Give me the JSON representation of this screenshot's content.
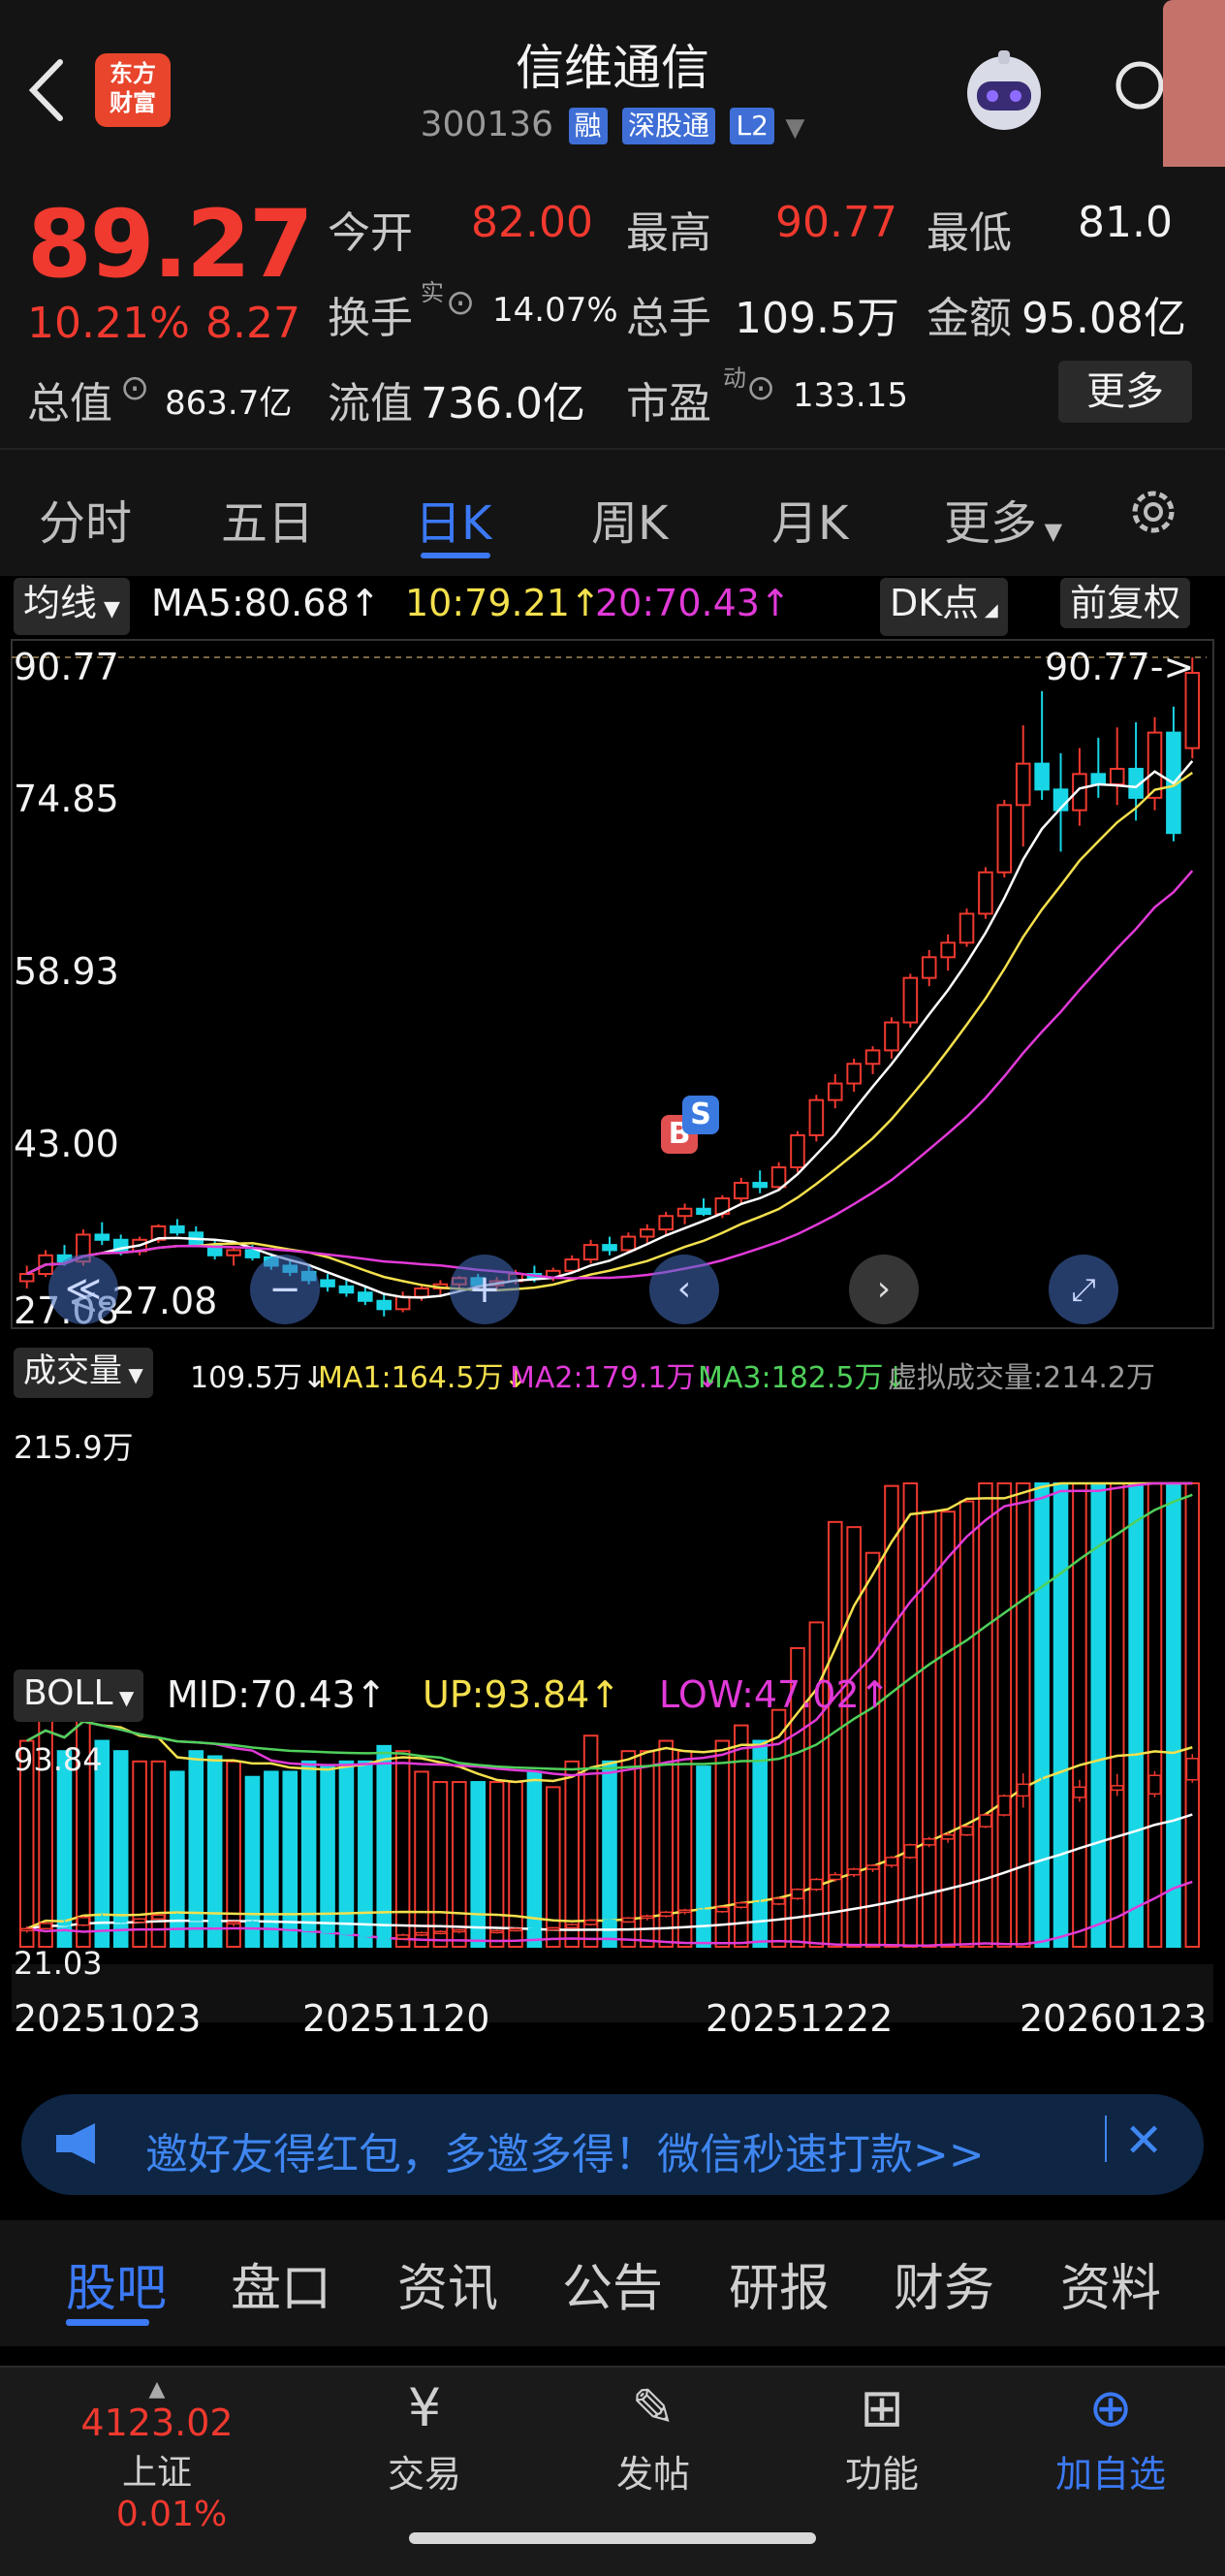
{
  "header": {
    "stock_name": "信维通信",
    "stock_code": "300136",
    "tags": [
      "融",
      "深股通",
      "L2"
    ],
    "logo_text": [
      "东方",
      "财富"
    ]
  },
  "quote": {
    "price": "89.27",
    "change_pct": "10.21%",
    "change": "8.27",
    "fields": [
      {
        "label": "今开",
        "value": "82.00",
        "color": "red"
      },
      {
        "label": "最高",
        "value": "90.77",
        "color": "red"
      },
      {
        "label": "最低",
        "value": "81.0",
        "color": "white"
      },
      {
        "label": "换手",
        "sup": "实",
        "value": "14.07%",
        "color": "white"
      },
      {
        "label": "总手",
        "value": "109.5万",
        "color": "white"
      },
      {
        "label": "金额",
        "value": "95.08亿",
        "color": "white"
      },
      {
        "label": "总值",
        "value": "863.7亿",
        "color": "white"
      },
      {
        "label": "流值",
        "value": "736.0亿",
        "color": "white"
      },
      {
        "label": "市盈",
        "sup": "动",
        "value": "133.15",
        "color": "white"
      }
    ],
    "more_label": "更多"
  },
  "period_tabs": [
    "分时",
    "五日",
    "日K",
    "周K",
    "月K",
    "更多"
  ],
  "active_period": "日K",
  "ma_bar": {
    "selector": "均线",
    "ma5": "MA5:80.68",
    "ma10": "10:79.21",
    "ma20": "20:70.43",
    "dk_label": "DK点",
    "adjust_label": "前复权"
  },
  "kline": {
    "y_ticks": [
      "90.77",
      "74.85",
      "58.93",
      "43.00",
      "27.08"
    ],
    "high_label": "90.77->",
    "low_label": "<-27.08",
    "markers": [
      "B",
      "S"
    ]
  },
  "volume_bar": {
    "selector": "成交量",
    "vol": "109.5万",
    "ma1": "MA1:164.5万",
    "ma2": "MA2:179.1万",
    "ma3": "MA3:182.5万",
    "virtual": "虚拟成交量:214.2万",
    "y_tick": "215.9万"
  },
  "boll_bar": {
    "selector": "BOLL",
    "mid": "MID:70.43",
    "up": "UP:93.84",
    "low": "LOW:47.02",
    "y_top": "93.84",
    "y_bottom": "21.03"
  },
  "x_dates": [
    "20251023",
    "20251120",
    "20251222",
    "20260123"
  ],
  "chart_data": {
    "type": "candlestick",
    "title": "",
    "x_start": "20251023",
    "x_end": "20260123",
    "ylim": [
      27.08,
      90.77
    ],
    "ohlc": [
      [
        30.5,
        32.0,
        29.8,
        31.2
      ],
      [
        31.2,
        33.5,
        30.9,
        33.0
      ],
      [
        33.0,
        34.0,
        32.0,
        32.4
      ],
      [
        32.4,
        35.5,
        32.0,
        35.0
      ],
      [
        35.0,
        36.2,
        34.0,
        34.5
      ],
      [
        34.5,
        35.0,
        33.0,
        33.4
      ],
      [
        33.4,
        34.8,
        33.0,
        34.5
      ],
      [
        34.5,
        36.0,
        34.2,
        35.8
      ],
      [
        35.8,
        36.5,
        34.9,
        35.2
      ],
      [
        35.2,
        35.8,
        33.8,
        34.0
      ],
      [
        34.0,
        34.5,
        32.6,
        33.0
      ],
      [
        33.0,
        33.8,
        32.0,
        33.5
      ],
      [
        33.5,
        34.0,
        32.5,
        32.8
      ],
      [
        32.8,
        33.2,
        31.6,
        32.0
      ],
      [
        32.0,
        32.6,
        31.0,
        31.4
      ],
      [
        31.4,
        32.0,
        30.2,
        30.6
      ],
      [
        30.6,
        31.2,
        29.5,
        30.0
      ],
      [
        30.0,
        30.8,
        29.0,
        29.4
      ],
      [
        29.4,
        30.0,
        28.2,
        28.6
      ],
      [
        28.6,
        29.2,
        27.1,
        27.8
      ],
      [
        27.8,
        29.5,
        27.5,
        29.0
      ],
      [
        29.0,
        30.2,
        28.6,
        29.8
      ],
      [
        29.8,
        30.6,
        29.2,
        30.2
      ],
      [
        30.2,
        31.0,
        29.6,
        30.8
      ],
      [
        30.8,
        31.2,
        29.8,
        30.1
      ],
      [
        30.1,
        30.9,
        29.5,
        30.5
      ],
      [
        30.5,
        31.6,
        30.2,
        31.2
      ],
      [
        31.2,
        32.0,
        30.4,
        30.8
      ],
      [
        30.8,
        31.8,
        30.5,
        31.5
      ],
      [
        31.5,
        33.0,
        31.2,
        32.6
      ],
      [
        32.6,
        34.5,
        32.2,
        34.0
      ],
      [
        34.0,
        34.8,
        33.0,
        33.5
      ],
      [
        33.5,
        35.2,
        33.2,
        34.8
      ],
      [
        34.8,
        36.0,
        34.0,
        35.5
      ],
      [
        35.5,
        37.2,
        35.0,
        36.8
      ],
      [
        36.8,
        38.0,
        36.0,
        37.5
      ],
      [
        37.5,
        38.5,
        36.8,
        37.0
      ],
      [
        37.0,
        38.8,
        36.6,
        38.5
      ],
      [
        38.5,
        40.5,
        38.0,
        40.0
      ],
      [
        40.0,
        41.2,
        39.0,
        39.6
      ],
      [
        39.6,
        42.0,
        39.2,
        41.5
      ],
      [
        41.5,
        45.0,
        41.0,
        44.6
      ],
      [
        44.6,
        48.5,
        44.0,
        48.0
      ],
      [
        48.0,
        50.5,
        47.2,
        49.6
      ],
      [
        49.6,
        52.0,
        48.8,
        51.5
      ],
      [
        51.5,
        53.2,
        50.5,
        52.8
      ],
      [
        52.8,
        56.0,
        52.0,
        55.5
      ],
      [
        55.5,
        60.2,
        55.0,
        59.8
      ],
      [
        59.8,
        62.5,
        59.0,
        61.8
      ],
      [
        61.8,
        64.0,
        60.5,
        63.2
      ],
      [
        63.2,
        66.5,
        62.8,
        66.0
      ],
      [
        66.0,
        70.5,
        65.5,
        70.0
      ],
      [
        70.0,
        77.0,
        69.5,
        76.5
      ],
      [
        76.5,
        84.2,
        72.5,
        80.5
      ],
      [
        80.5,
        87.5,
        77.0,
        78.0
      ],
      [
        78.0,
        81.5,
        72.0,
        76.0
      ],
      [
        76.0,
        82.0,
        74.5,
        79.5
      ],
      [
        79.5,
        83.0,
        77.2,
        78.5
      ],
      [
        78.5,
        84.0,
        76.5,
        80.0
      ],
      [
        80.0,
        84.5,
        75.0,
        77.2
      ],
      [
        77.2,
        85.0,
        76.0,
        83.5
      ],
      [
        83.5,
        86.0,
        73.0,
        73.8
      ],
      [
        82.0,
        90.77,
        81.0,
        89.27
      ]
    ]
  }
}
